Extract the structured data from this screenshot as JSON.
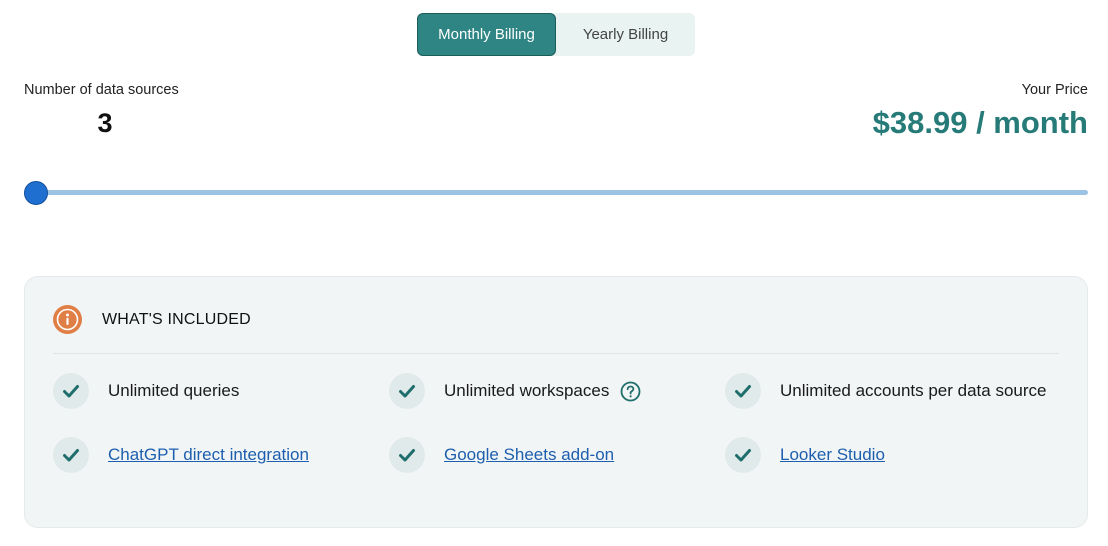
{
  "billing": {
    "monthly_label": "Monthly Billing",
    "yearly_label": "Yearly Billing",
    "selected": "monthly"
  },
  "data_sources": {
    "label": "Number of data sources",
    "value": "3"
  },
  "price": {
    "label": "Your Price",
    "value": "$38.99 / month"
  },
  "slider": {
    "fill_fraction": 0.0
  },
  "included": {
    "title": "WHAT'S INCLUDED",
    "icon": "info-icon",
    "features": [
      {
        "label": "Unlimited queries",
        "is_link": false,
        "icon": "check-icon"
      },
      {
        "label": "Unlimited workspaces",
        "is_link": false,
        "icon": "check-icon",
        "help_icon": "help-icon"
      },
      {
        "label": "Unlimited accounts per data source",
        "is_link": false,
        "icon": "check-icon"
      },
      {
        "label": "ChatGPT direct integration",
        "is_link": true,
        "icon": "check-icon"
      },
      {
        "label": "Google Sheets add-on",
        "is_link": true,
        "icon": "check-icon"
      },
      {
        "label": "Looker Studio",
        "is_link": true,
        "icon": "check-icon"
      }
    ]
  },
  "colors": {
    "accent_teal": "#2f8583",
    "price_teal": "#267a77",
    "slider_blue": "#1f6fd1",
    "info_orange": "#e07f45",
    "link_blue": "#1d5fae"
  }
}
